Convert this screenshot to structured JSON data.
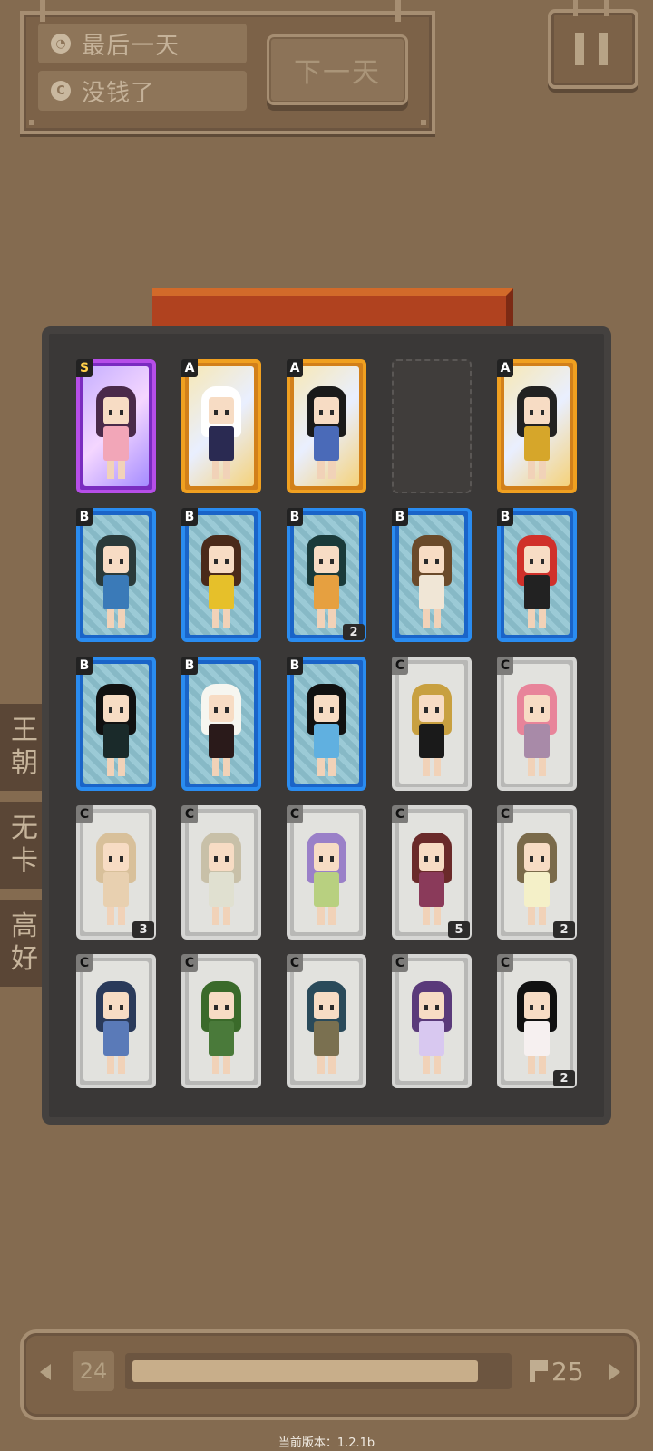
{
  "status": {
    "day_text": "最后一天",
    "money_text": "没钱了",
    "next_day_label": "下一天"
  },
  "side_tabs": [
    {
      "lines": [
        "王",
        "朝"
      ]
    },
    {
      "lines": [
        "无",
        "卡"
      ]
    },
    {
      "lines": [
        "高",
        "好"
      ]
    }
  ],
  "colors": {
    "S": "#b64ee8",
    "A": "#f0a020",
    "B": "#2a8cf0",
    "C": "#d6d6d4"
  },
  "cards": [
    {
      "rank": "S",
      "count": "",
      "hair": "#4a2a4a",
      "outfit": "#f2a6b8"
    },
    {
      "rank": "A",
      "count": "",
      "hair": "#ffffff",
      "outfit": "#2a2a52"
    },
    {
      "rank": "A",
      "count": "",
      "hair": "#1a1a1a",
      "outfit": "#4a6ab8"
    },
    {
      "rank": "",
      "count": "",
      "hair": "",
      "outfit": ""
    },
    {
      "rank": "A",
      "count": "",
      "hair": "#222222",
      "outfit": "#d6a62a"
    },
    {
      "rank": "B",
      "count": "",
      "hair": "#2a3a3a",
      "outfit": "#3a7ab8"
    },
    {
      "rank": "B",
      "count": "",
      "hair": "#4a2a1a",
      "outfit": "#e6c02a"
    },
    {
      "rank": "B",
      "count": "2",
      "hair": "#1a3a3a",
      "outfit": "#e6a040"
    },
    {
      "rank": "B",
      "count": "",
      "hair": "#6a4a2a",
      "outfit": "#f0e6d6"
    },
    {
      "rank": "B",
      "count": "",
      "hair": "#d0302a",
      "outfit": "#222222"
    },
    {
      "rank": "B",
      "count": "",
      "hair": "#111111",
      "outfit": "#1a2a2a"
    },
    {
      "rank": "B",
      "count": "",
      "hair": "#f6f6f0",
      "outfit": "#2a1a1a"
    },
    {
      "rank": "B",
      "count": "",
      "hair": "#111111",
      "outfit": "#60b0e0"
    },
    {
      "rank": "C",
      "count": "",
      "hair": "#c8a040",
      "outfit": "#1a1a1a"
    },
    {
      "rank": "C",
      "count": "",
      "hair": "#e8849a",
      "outfit": "#a88aa8"
    },
    {
      "rank": "C",
      "count": "3",
      "hair": "#d8c09a",
      "outfit": "#e8d0b0"
    },
    {
      "rank": "C",
      "count": "",
      "hair": "#c8c0a8",
      "outfit": "#e0e0d0"
    },
    {
      "rank": "C",
      "count": "",
      "hair": "#9a80c8",
      "outfit": "#b8d080"
    },
    {
      "rank": "C",
      "count": "5",
      "hair": "#6a2a2a",
      "outfit": "#8a3a5a"
    },
    {
      "rank": "C",
      "count": "2",
      "hair": "#7a6a4a",
      "outfit": "#f4f0c8"
    },
    {
      "rank": "C",
      "count": "",
      "hair": "#2a3a5a",
      "outfit": "#5a7ab8"
    },
    {
      "rank": "C",
      "count": "",
      "hair": "#3a6a2a",
      "outfit": "#4a7a3a"
    },
    {
      "rank": "C",
      "count": "",
      "hair": "#2a4a5a",
      "outfit": "#7a7050"
    },
    {
      "rank": "C",
      "count": "",
      "hair": "#5a3a7a",
      "outfit": "#d8c8f0"
    },
    {
      "rank": "C",
      "count": "2",
      "hair": "#111111",
      "outfit": "#f6f0f0"
    }
  ],
  "progress": {
    "level": "24",
    "goal": "25",
    "fill_fraction": 0.93
  },
  "version_text": "当前版本：1.2.1b"
}
